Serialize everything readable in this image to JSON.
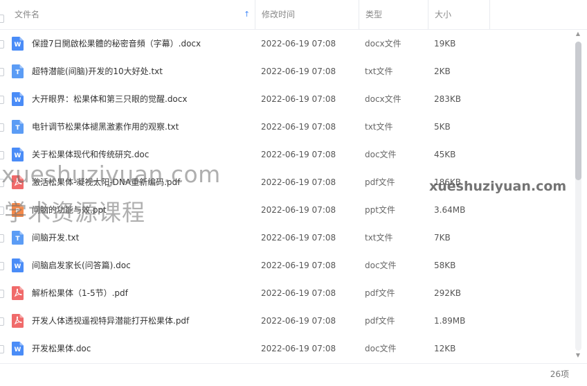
{
  "header": {
    "name": "文件名",
    "modified": "修改时间",
    "type": "类型",
    "size": "大小",
    "sort_arrow": "↑"
  },
  "files": [
    {
      "name": "保證7日開啟松果體的秘密音頻（字幕）.docx",
      "date": "2022-06-19 07:08",
      "type": "docx文件",
      "size": "19KB",
      "icon": "word-file-icon"
    },
    {
      "name": "超特潜能(间脑)开发的10大好处.txt",
      "date": "2022-06-19 07:08",
      "type": "txt文件",
      "size": "2KB",
      "icon": "text-file-icon"
    },
    {
      "name": "大开眼界：松果体和第三只眼的觉醒.docx",
      "date": "2022-06-19 07:08",
      "type": "docx文件",
      "size": "283KB",
      "icon": "word-file-icon"
    },
    {
      "name": "电针调节松果体褪黑激素作用的观察.txt",
      "date": "2022-06-19 07:08",
      "type": "txt文件",
      "size": "5KB",
      "icon": "text-file-icon"
    },
    {
      "name": "关于松果体现代和传统研究.doc",
      "date": "2022-06-19 07:08",
      "type": "doc文件",
      "size": "45KB",
      "icon": "word-file-icon"
    },
    {
      "name": "激活松果体-凝视太阳-DNA重新编码.pdf",
      "date": "2022-06-19 07:08",
      "type": "pdf文件",
      "size": "186KB",
      "icon": "pdf-file-icon"
    },
    {
      "name": "间脑的功能与效.ppt",
      "date": "2022-06-19 07:08",
      "type": "ppt文件",
      "size": "3.64MB",
      "icon": "ppt-file-icon"
    },
    {
      "name": "间脑开发.txt",
      "date": "2022-06-19 07:08",
      "type": "txt文件",
      "size": "7KB",
      "icon": "text-file-icon"
    },
    {
      "name": "间脑启发家长(问答篇).doc",
      "date": "2022-06-19 07:08",
      "type": "doc文件",
      "size": "58KB",
      "icon": "word-file-icon"
    },
    {
      "name": "解析松果体（1-5节）.pdf",
      "date": "2022-06-19 07:08",
      "type": "pdf文件",
      "size": "292KB",
      "icon": "pdf-file-icon"
    },
    {
      "name": "开发人体透视遥视特异潜能打开松果体.pdf",
      "date": "2022-06-19 07:08",
      "type": "pdf文件",
      "size": "1.89MB",
      "icon": "pdf-file-icon"
    },
    {
      "name": "开发松果体.doc",
      "date": "2022-06-19 07:08",
      "type": "doc文件",
      "size": "12KB",
      "icon": "word-file-icon"
    }
  ],
  "footer": {
    "count": "26项"
  },
  "watermarks": {
    "left_url": "xueshuziyuan.com",
    "left_cn": "学术资源课程",
    "right_url": "xueshuziyuan.com"
  },
  "colors": {
    "word": "#4a8cf7",
    "text": "#5b9cf5",
    "pdf": "#f06a6a",
    "ppt": "#f58a4b",
    "accent": "#4a8df8"
  }
}
